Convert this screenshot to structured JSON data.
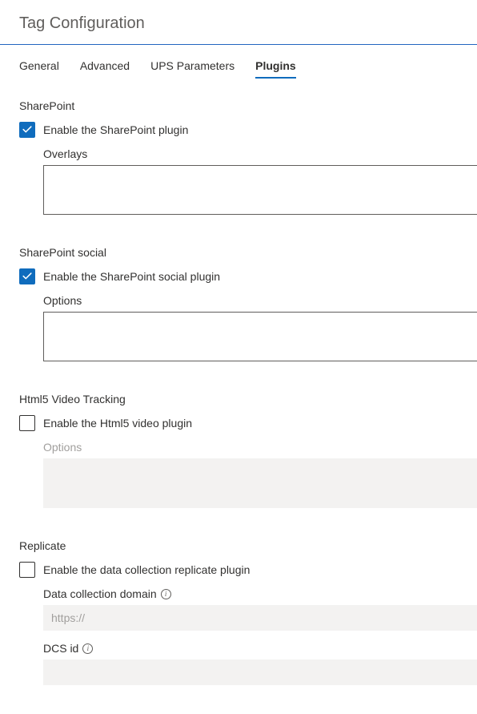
{
  "page_title": "Tag Configuration",
  "tabs": [
    {
      "label": "General",
      "active": false
    },
    {
      "label": "Advanced",
      "active": false
    },
    {
      "label": "UPS Parameters",
      "active": false
    },
    {
      "label": "Plugins",
      "active": true
    }
  ],
  "sections": {
    "sharepoint": {
      "title": "SharePoint",
      "checkbox_label": "Enable the SharePoint plugin",
      "checked": true,
      "field_label": "Overlays",
      "field_value": ""
    },
    "sharepoint_social": {
      "title": "SharePoint social",
      "checkbox_label": "Enable the SharePoint social plugin",
      "checked": true,
      "field_label": "Options",
      "field_value": ""
    },
    "html5_video": {
      "title": "Html5 Video Tracking",
      "checkbox_label": "Enable the Html5 video plugin",
      "checked": false,
      "field_label": "Options",
      "field_value": ""
    },
    "replicate": {
      "title": "Replicate",
      "checkbox_label": "Enable the data collection replicate plugin",
      "checked": false,
      "domain_label": "Data collection domain",
      "domain_placeholder": "https://",
      "domain_value": "",
      "dcsid_label": "DCS id",
      "dcsid_value": ""
    }
  }
}
